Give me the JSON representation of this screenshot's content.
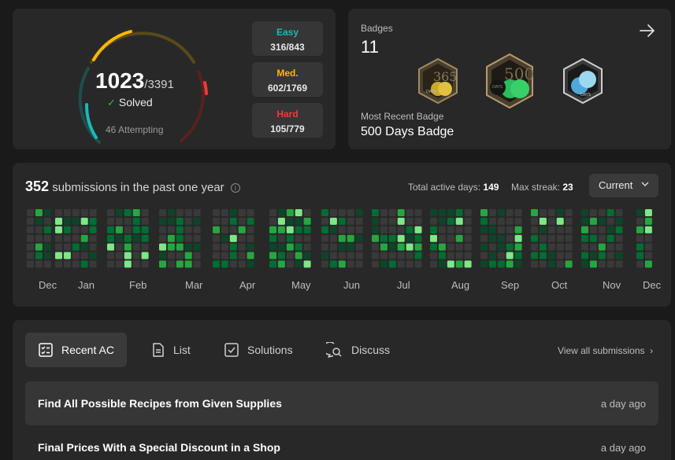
{
  "solved": {
    "count": "1023",
    "total": "/3391",
    "label": "Solved",
    "attempting": "46 Attempting"
  },
  "difficulty": [
    {
      "name": "Easy",
      "value": "316/843",
      "color": "#1cb8b8"
    },
    {
      "name": "Med.",
      "value": "602/1769",
      "color": "#ffb700"
    },
    {
      "name": "Hard",
      "value": "105/779",
      "color": "#f63737"
    }
  ],
  "badges": {
    "label": "Badges",
    "count": "11",
    "recent_label": "Most Recent Badge",
    "recent_name": "500 Days Badge",
    "icons": [
      "365-days-badge-icon",
      "500-days-badge-icon",
      "annual-badge-icon"
    ]
  },
  "submissions": {
    "count": "352",
    "text": "submissions in the past one year",
    "active_days_label": "Total active days:",
    "active_days": "149",
    "max_streak_label": "Max streak:",
    "max_streak": "23",
    "period": "Current",
    "months": [
      "Dec",
      "Jan",
      "Feb",
      "Mar",
      "Apr",
      "May",
      "Jun",
      "Jul",
      "Aug",
      "Sep",
      "Oct",
      "Nov",
      "Dec"
    ],
    "level_colors": [
      "#393939",
      "#0e4429",
      "#006d32",
      "#26a641",
      "#7ee787"
    ]
  },
  "tabs": [
    {
      "label": "Recent AC",
      "icon": "checklist-icon",
      "active": true
    },
    {
      "label": "List",
      "icon": "document-icon",
      "active": false
    },
    {
      "label": "Solutions",
      "icon": "checkbox-icon",
      "active": false
    },
    {
      "label": "Discuss",
      "icon": "discuss-icon",
      "active": false
    }
  ],
  "view_all": "View all submissions",
  "recent_ac": [
    {
      "title": "Find All Possible Recipes from Given Supplies",
      "time": "a day ago"
    },
    {
      "title": "Final Prices With a Special Discount in a Shop",
      "time": "a day ago"
    }
  ]
}
